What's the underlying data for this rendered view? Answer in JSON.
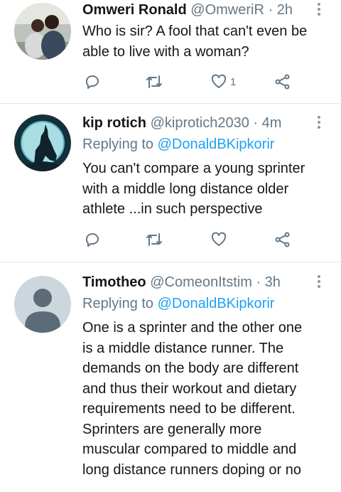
{
  "tweets": [
    {
      "name": "Omweri Ronald",
      "handle": "@OmweriR",
      "dot": "·",
      "time": "2h",
      "replying_prefix": "",
      "replying_to": "",
      "lines": [
        "Who is sir? A fool that can't even be",
        "able to live with a woman?"
      ],
      "like_count": "1",
      "avatar": "photo-two-people"
    },
    {
      "name": "kip rotich",
      "handle": "@kiprotich2030",
      "dot": "·",
      "time": "4m",
      "replying_prefix": "Replying to",
      "replying_to": "@DonaldBKipkorir",
      "lines": [
        "You can't compare a young sprinter",
        "with a middle long distance older",
        "athlete ...in such perspective"
      ],
      "like_count": "",
      "avatar": "howling-wolf-moon"
    },
    {
      "name": "Timotheo",
      "handle": "@ComeonItstim",
      "dot": "·",
      "time": "3h",
      "replying_prefix": "Replying to",
      "replying_to": "@DonaldBKipkorir",
      "lines": [
        "One is a sprinter and the other one",
        "is a middle distance runner. The",
        "demands on the body are different",
        "and thus their workout and dietary",
        "requirements need to be different.",
        "Sprinters are generally more",
        "muscular compared to middle and",
        "long distance runners doping or no"
      ],
      "like_count": "",
      "avatar": "default-person"
    }
  ],
  "icons": {
    "reply": "reply-icon",
    "retweet": "retweet-icon",
    "like": "heart-icon",
    "share": "share-icon",
    "menu": "more-vertical-icon"
  },
  "colors": {
    "name": "#14171a",
    "muted": "#657786",
    "link": "#1da1f2",
    "divider": "#e1e8ed"
  }
}
